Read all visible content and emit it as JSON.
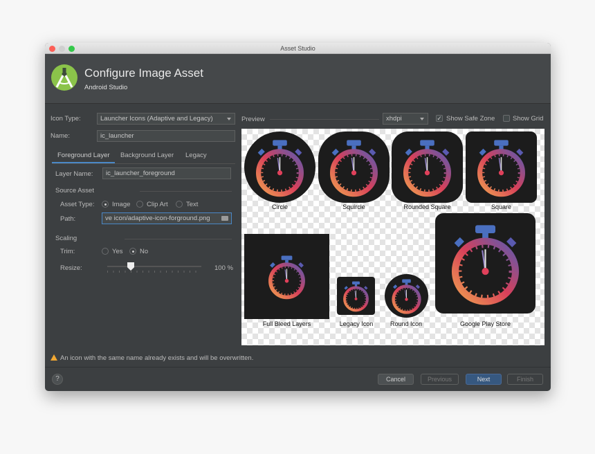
{
  "window": {
    "title": "Asset Studio"
  },
  "header": {
    "title": "Configure Image Asset",
    "subtitle": "Android Studio"
  },
  "form": {
    "icon_type_label": "Icon Type:",
    "icon_type_value": "Launcher Icons (Adaptive and Legacy)",
    "name_label": "Name:",
    "name_value": "ic_launcher",
    "tabs": [
      {
        "label": "Foreground Layer",
        "active": true
      },
      {
        "label": "Background Layer",
        "active": false
      },
      {
        "label": "Legacy",
        "active": false
      }
    ],
    "layer_name_label": "Layer Name:",
    "layer_name_value": "ic_launcher_foreground",
    "source_asset_label": "Source Asset",
    "asset_type_label": "Asset Type:",
    "asset_types": [
      {
        "label": "Image",
        "selected": true
      },
      {
        "label": "Clip Art",
        "selected": false
      },
      {
        "label": "Text",
        "selected": false
      }
    ],
    "path_label": "Path:",
    "path_value": "ve icon/adaptive-icon-forground.png",
    "scaling_label": "Scaling",
    "trim_label": "Trim:",
    "trim_options": [
      {
        "label": "Yes",
        "selected": false
      },
      {
        "label": "No",
        "selected": true
      }
    ],
    "resize_label": "Resize:",
    "resize_value": "100 %",
    "resize_percent": 100
  },
  "preview": {
    "label": "Preview",
    "density": "xhdpi",
    "show_safe_zone": {
      "label": "Show Safe Zone",
      "checked": true
    },
    "show_grid": {
      "label": "Show Grid",
      "checked": false
    },
    "shapes": [
      "Circle",
      "Squircle",
      "Rounded Square",
      "Square",
      "Full Bleed Layers",
      "Legacy Icon",
      "Round Icon",
      "Google Play Store"
    ]
  },
  "warning": "An icon with the same name already exists and will be overwritten.",
  "buttons": {
    "help": "?",
    "cancel": "Cancel",
    "previous": "Previous",
    "next": "Next",
    "finish": "Finish"
  },
  "colors": {
    "accent": "#4a88c7",
    "primary_button": "#365880",
    "warning": "#f0a732",
    "logo": "#8bc34a"
  }
}
